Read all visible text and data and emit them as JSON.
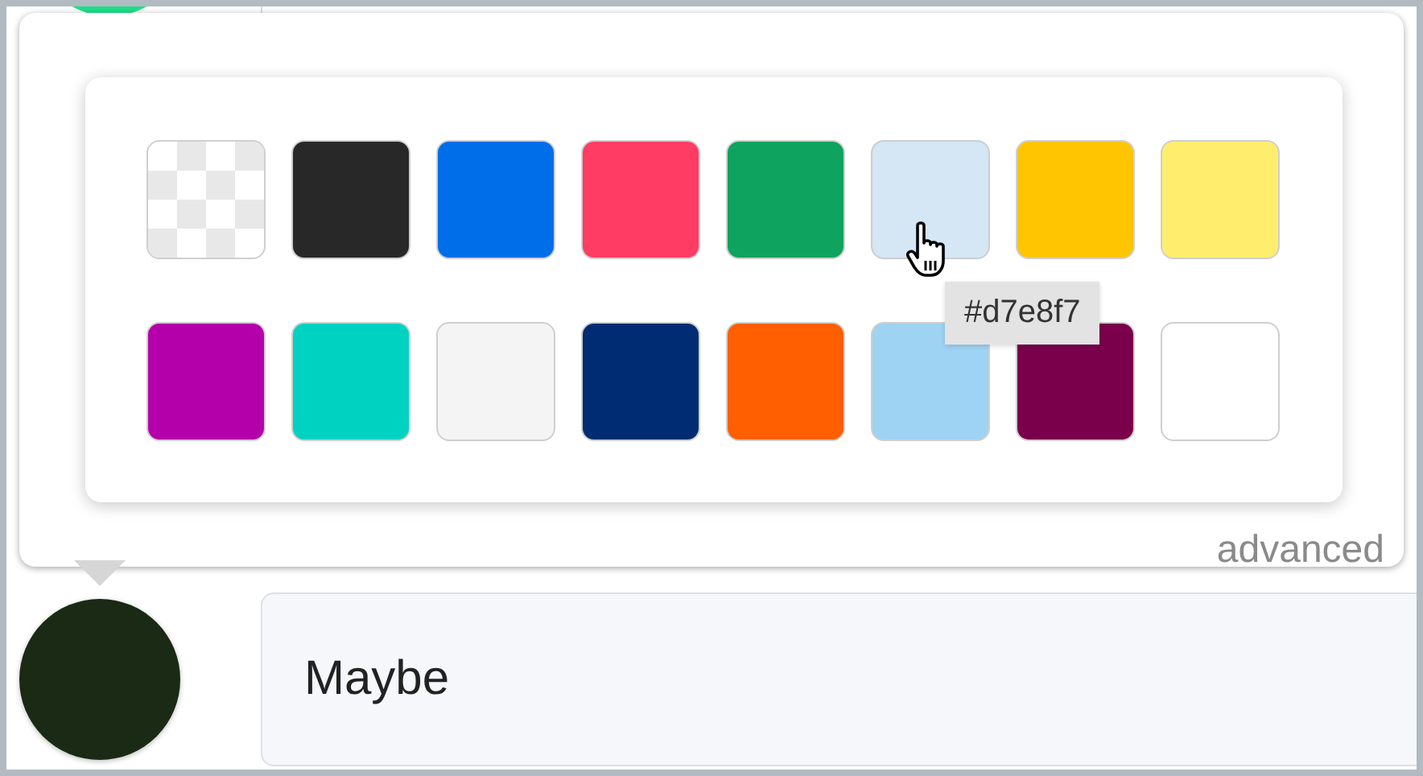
{
  "rows": [
    {
      "color": "#1ee08a"
    },
    {
      "color": "#1a2a14",
      "value": "Maybe"
    }
  ],
  "picker": {
    "swatch_rows": [
      [
        {
          "kind": "transparent",
          "hovered": false
        },
        {
          "kind": "color",
          "color": "#282828",
          "hovered": false
        },
        {
          "kind": "color",
          "color": "#006ee9",
          "hovered": false
        },
        {
          "kind": "color",
          "color": "#ff3c63",
          "hovered": false
        },
        {
          "kind": "color",
          "color": "#0ea35e",
          "hovered": false
        },
        {
          "kind": "color",
          "color": "#d7e8f7",
          "hovered": true
        },
        {
          "kind": "color",
          "color": "#ffc500",
          "hovered": false
        },
        {
          "kind": "color",
          "color": "#ffee6e",
          "hovered": false
        }
      ],
      [
        {
          "kind": "color",
          "color": "#b400aa",
          "hovered": false
        },
        {
          "kind": "color",
          "color": "#00d2c2",
          "hovered": false
        },
        {
          "kind": "color",
          "color": "#f4f4f4",
          "hovered": false
        },
        {
          "kind": "color",
          "color": "#002c73",
          "hovered": false
        },
        {
          "kind": "color",
          "color": "#ff5f00",
          "hovered": false
        },
        {
          "kind": "color",
          "color": "#9fd3f3",
          "hovered": false
        },
        {
          "kind": "color",
          "color": "#7a004c",
          "hovered": false
        },
        {
          "kind": "color",
          "color": "#ffffff",
          "hovered": false
        }
      ]
    ],
    "tooltip": "#d7e8f7",
    "advanced_link": "advanced"
  }
}
